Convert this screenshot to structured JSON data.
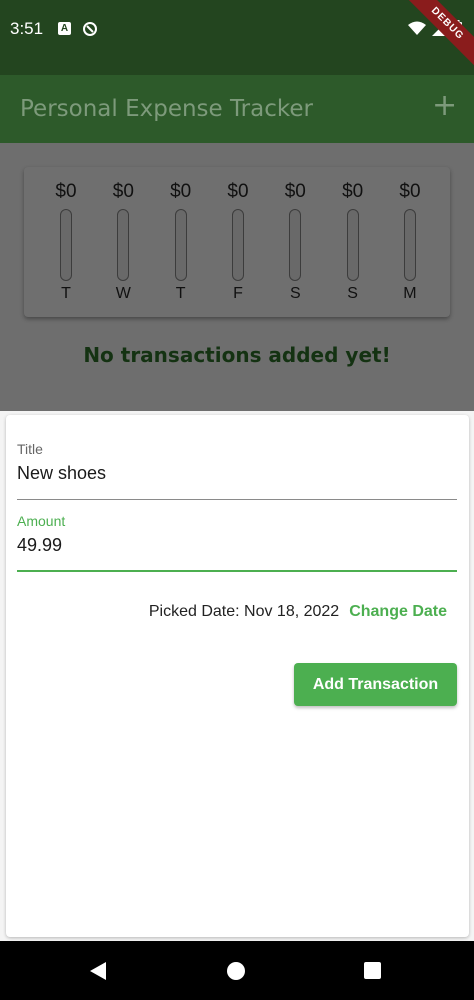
{
  "status_bar": {
    "time": "3:51",
    "icons": [
      "a-icon",
      "q-icon",
      "wifi-icon",
      "signal-icon",
      "battery-icon"
    ],
    "debug_label": "DEBUG"
  },
  "app_bar": {
    "title": "Personal Expense Tracker",
    "add_icon": "+"
  },
  "chart": {
    "bars": [
      {
        "amount": "$0",
        "day": "T",
        "fill_fraction": 0
      },
      {
        "amount": "$0",
        "day": "W",
        "fill_fraction": 0
      },
      {
        "amount": "$0",
        "day": "T",
        "fill_fraction": 0
      },
      {
        "amount": "$0",
        "day": "F",
        "fill_fraction": 0
      },
      {
        "amount": "$0",
        "day": "S",
        "fill_fraction": 0
      },
      {
        "amount": "$0",
        "day": "S",
        "fill_fraction": 0
      },
      {
        "amount": "$0",
        "day": "M",
        "fill_fraction": 0
      }
    ]
  },
  "empty_message": "No transactions added yet!",
  "form": {
    "title_label": "Title",
    "title_value": "New shoes",
    "amount_label": "Amount",
    "amount_value": "49.99",
    "picked_date": "Picked Date: Nov 18, 2022",
    "change_date_label": "Change Date",
    "submit_label": "Add Transaction"
  },
  "colors": {
    "primary": "#4caf50",
    "app_bar": "#2d5a2a",
    "status_bar": "#23451f"
  }
}
